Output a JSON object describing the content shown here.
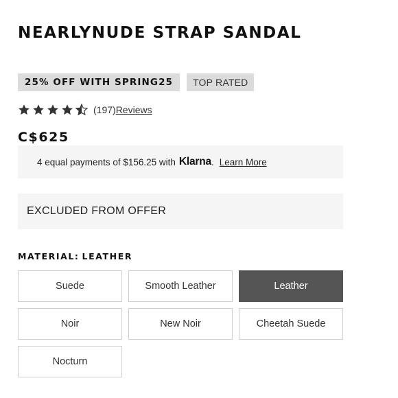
{
  "product": {
    "title": "NEARLYNUDE STRAP SANDAL",
    "price": "C$625"
  },
  "badges": {
    "promo": "25% OFF WITH SPRING25",
    "top_rated": "TOP RATED"
  },
  "rating": {
    "stars": 4.5,
    "max_stars": 5,
    "count": "(197)",
    "reviews_link": "Reviews"
  },
  "klarna": {
    "text": "4 equal payments of $156.25 with",
    "logo": "Klarna",
    "period": ".",
    "learn_more": "Learn More"
  },
  "offer_notice": "EXCLUDED FROM OFFER",
  "material": {
    "label": "MATERIAL:",
    "selected": "LEATHER",
    "options": [
      {
        "label": "Suede",
        "selected": false
      },
      {
        "label": "Smooth Leather",
        "selected": false
      },
      {
        "label": "Leather",
        "selected": true
      },
      {
        "label": "Noir",
        "selected": false
      },
      {
        "label": "New Noir",
        "selected": false
      },
      {
        "label": "Cheetah Suede",
        "selected": false
      },
      {
        "label": "Nocturn",
        "selected": false
      }
    ]
  },
  "colors": {
    "badge_bg": "#dcdcdc",
    "panel_bg": "#f5f5f5",
    "selected_option_bg": "#555555",
    "star": "#333333"
  },
  "icons": {
    "star_full": "star-icon",
    "star_half": "star-half-icon"
  }
}
